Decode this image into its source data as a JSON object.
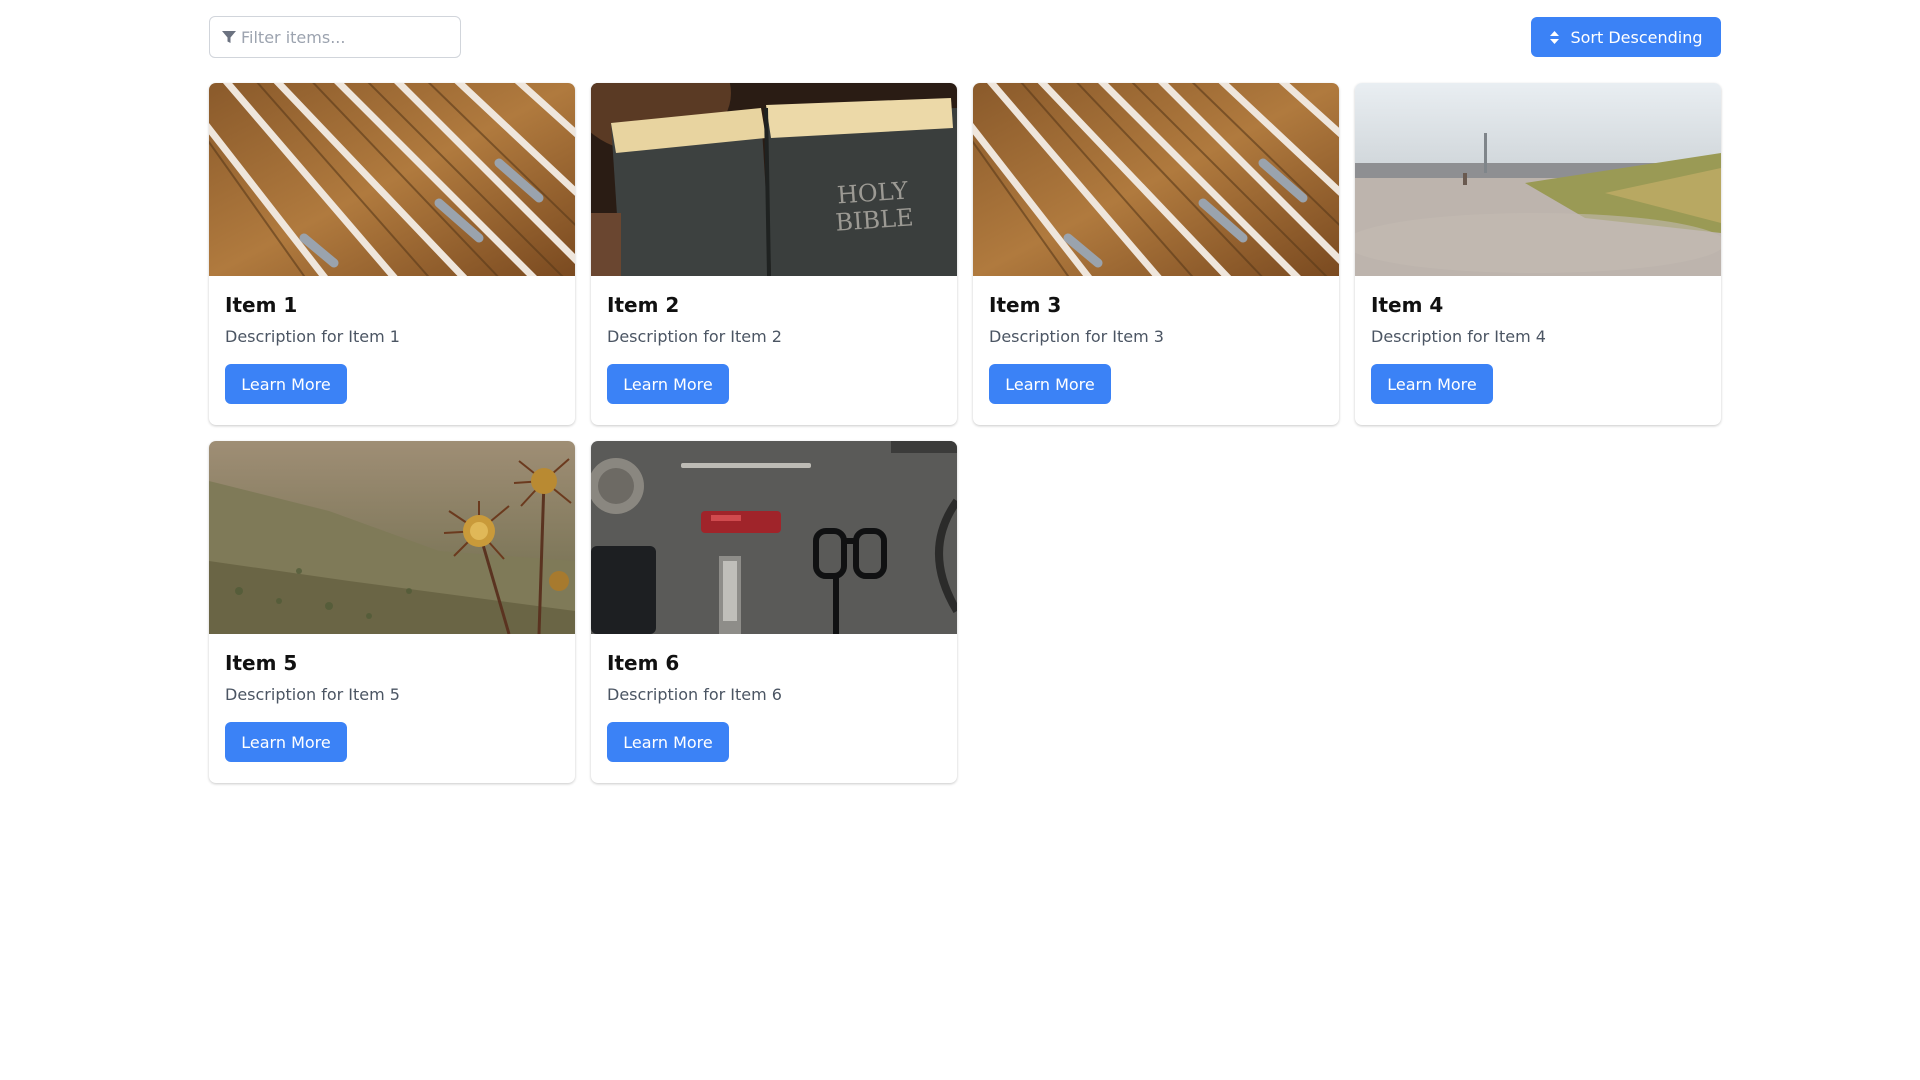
{
  "filter": {
    "placeholder": "Filter items..."
  },
  "sort_button": {
    "label": "Sort Descending"
  },
  "items": [
    {
      "title": "Item 1",
      "description": "Description for Item 1",
      "button": "Learn More"
    },
    {
      "title": "Item 2",
      "description": "Description for Item 2",
      "button": "Learn More"
    },
    {
      "title": "Item 3",
      "description": "Description for Item 3",
      "button": "Learn More"
    },
    {
      "title": "Item 4",
      "description": "Description for Item 4",
      "button": "Learn More"
    },
    {
      "title": "Item 5",
      "description": "Description for Item 5",
      "button": "Learn More"
    },
    {
      "title": "Item 6",
      "description": "Description for Item 6",
      "button": "Learn More"
    }
  ],
  "book_cover_text": [
    "HOLY",
    "BIBLE"
  ],
  "icons": {
    "filter": "filter-icon",
    "sort": "sort-icon"
  },
  "colors": {
    "accent": "#3b82f6",
    "border": "#d1d5db",
    "muted_text": "#4b5563"
  }
}
